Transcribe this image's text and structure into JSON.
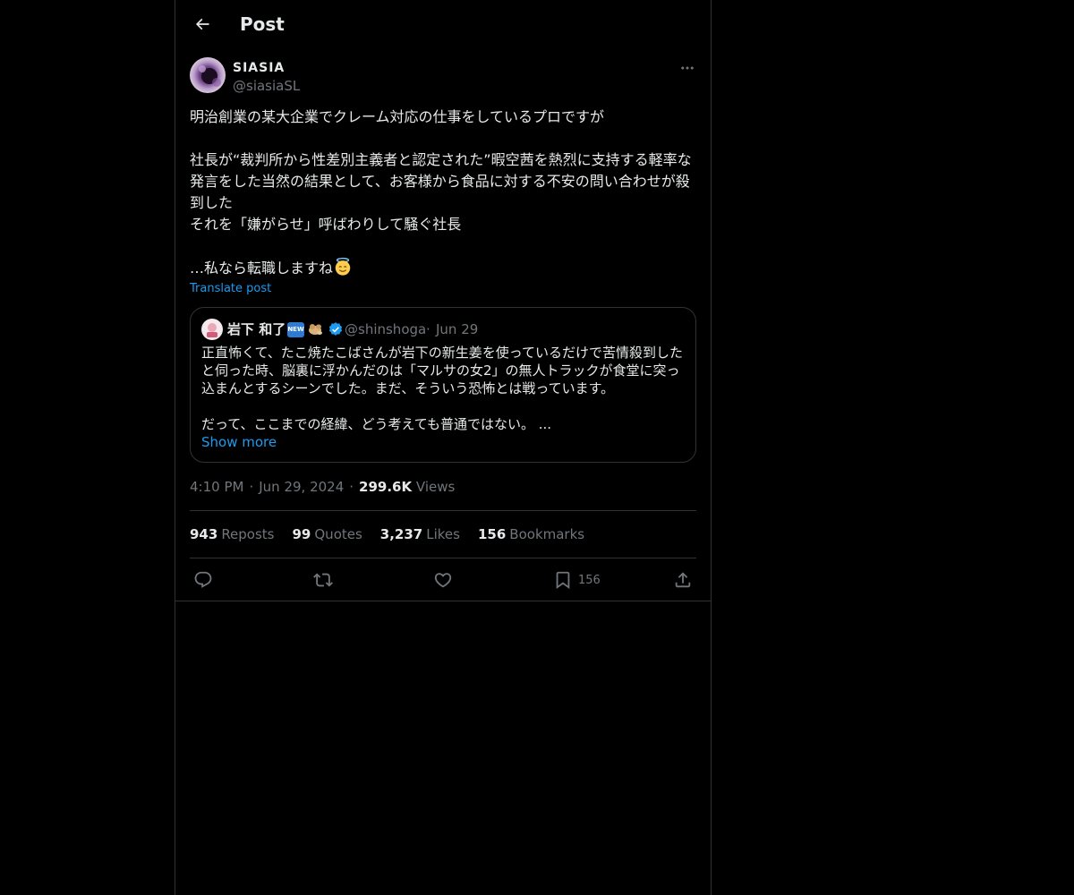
{
  "header": {
    "title": "Post",
    "back_icon": "arrow-left-icon"
  },
  "author": {
    "name": "SIASIA",
    "handle": "@siasiaSL"
  },
  "post": {
    "text_lines": [
      "明治創業の某大企業でクレーム対応の仕事をしているプロですが",
      "社長が“裁判所から性差別主義者と認定された”暇空茜を熱烈に支持する軽率な発言をした当然の結果として、お客様から食品に対する不安の問い合わせが殺到した\nそれを「嫌がらせ」呼ばわりして騒ぐ社長",
      "…私なら転職しますね"
    ],
    "emoji": "smiling-face-with-halo",
    "translate_label": "Translate post"
  },
  "quote": {
    "name": "岩下 和了",
    "badge_new": "NEW",
    "handle": "@shinshoga",
    "separator": "·",
    "date": "Jun 29",
    "paragraph_1": "正直怖くて、たこ焼たこばさんが岩下の新生姜を使っているだけで苦情殺到したと伺った時、脳裏に浮かんだのは「マルサの女2」の無人トラックが食堂に突っ込まんとするシーンでした。まだ、そういう恐怖とは戦っています。",
    "paragraph_2": "だって、ここまでの経緯、どう考えても普通ではない。 ...",
    "show_more": "Show more"
  },
  "meta": {
    "time": "4:10 PM",
    "separator": "·",
    "date": "Jun 29, 2024",
    "views_count": "299.6K",
    "views_label": "Views"
  },
  "stats": {
    "reposts_count": "943",
    "reposts_label": "Reposts",
    "quotes_count": "99",
    "quotes_label": "Quotes",
    "likes_count": "3,237",
    "likes_label": "Likes",
    "bookmarks_count": "156",
    "bookmarks_label": "Bookmarks"
  },
  "actions": {
    "bookmark_count": "156"
  },
  "colors": {
    "background": "#000000",
    "text_primary": "#e7e9ea",
    "text_secondary": "#71767b",
    "accent": "#1d9bf0",
    "border": "#2f3336",
    "verified": "#1d9bf0"
  }
}
